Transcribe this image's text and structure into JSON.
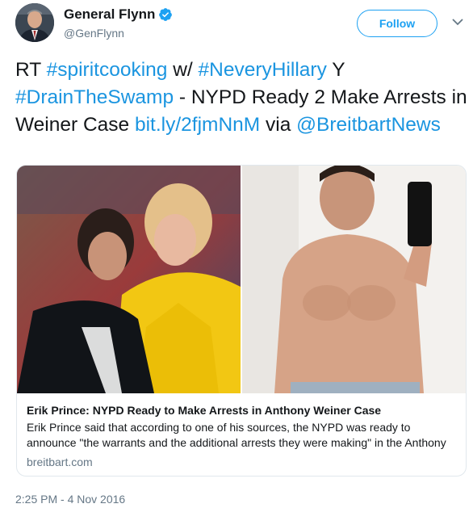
{
  "author": {
    "display_name": "General Flynn",
    "handle": "@GenFlynn",
    "verified_icon": "verified-badge-icon"
  },
  "follow_label": "Follow",
  "tweet": {
    "segments": [
      {
        "text": "RT ",
        "type": "text"
      },
      {
        "text": "#spiritcooking",
        "type": "link"
      },
      {
        "text": " w/ ",
        "type": "text"
      },
      {
        "text": "#NeveryHillary",
        "type": "link"
      },
      {
        "text": " Y ",
        "type": "text"
      },
      {
        "text": "#DrainTheSwamp",
        "type": "link"
      },
      {
        "text": " - NYPD Ready 2 Make Arrests in Weiner Case ",
        "type": "text"
      },
      {
        "text": "bit.ly/2fjmNnM",
        "type": "link"
      },
      {
        "text": " via ",
        "type": "text"
      },
      {
        "text": "@BreitbartNews",
        "type": "link"
      }
    ]
  },
  "card": {
    "title": "Erik Prince: NYPD Ready to Make Arrests in Anthony Weiner Case",
    "description": "Erik Prince said that according to one of his sources, the NYPD was ready to announce \"the warrants and the additional arrests they were making\" in the Anthony",
    "domain": "breitbart.com"
  },
  "timestamp": "2:25 PM - 4 Nov 2016",
  "colors": {
    "link": "#1b95e0",
    "follow_border": "#1da1f2",
    "secondary_text": "#657786"
  }
}
